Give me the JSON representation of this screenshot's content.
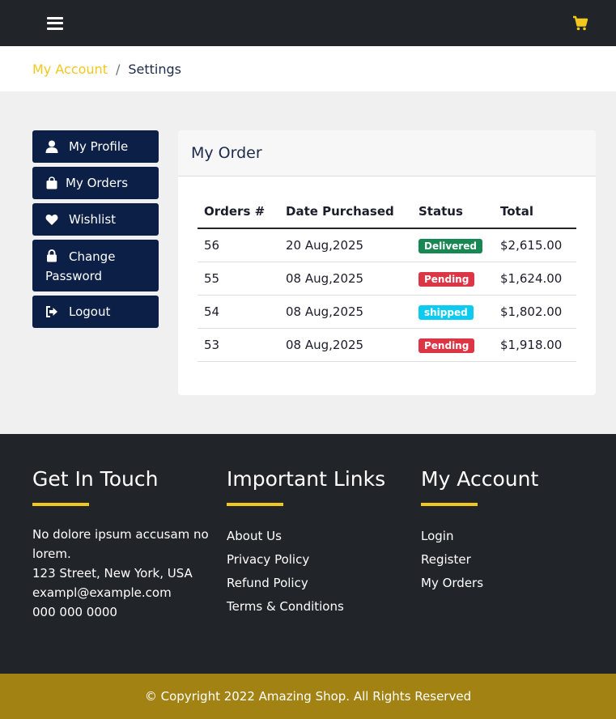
{
  "header": {
    "menu_icon": "hamburger-icon",
    "cart_icon": "shopping-cart-icon",
    "cart_color": "#f2c81c"
  },
  "breadcrumb": {
    "parent": "My Account",
    "separator": "/",
    "current": "Settings"
  },
  "sidebar": {
    "items": [
      {
        "label": "My Profile",
        "icon": "user-icon"
      },
      {
        "label": "My Orders",
        "icon": "shopping-bag-icon"
      },
      {
        "label": "Wishlist",
        "icon": "heart-icon"
      },
      {
        "label": "Change Password",
        "icon": "lock-icon"
      },
      {
        "label": "Logout",
        "icon": "logout-icon"
      }
    ]
  },
  "orders": {
    "title": "My Order",
    "columns": [
      "Orders #",
      "Date Purchased",
      "Status",
      "Total"
    ],
    "rows": [
      {
        "id": "56",
        "date": "20 Aug,2025",
        "status": "Delivered",
        "status_color": "#198754",
        "total": "$2,615.00"
      },
      {
        "id": "55",
        "date": "08 Aug,2025",
        "status": "Pending",
        "status_color": "#dc3545",
        "total": "$1,624.00"
      },
      {
        "id": "54",
        "date": "08 Aug,2025",
        "status": "shipped",
        "status_color": "#0dcaf0",
        "total": "$1,802.00"
      },
      {
        "id": "53",
        "date": "08 Aug,2025",
        "status": "Pending",
        "status_color": "#dc3545",
        "total": "$1,918.00"
      }
    ]
  },
  "footer": {
    "contact": {
      "title": "Get In Touch",
      "lines": [
        "No dolore ipsum accusam no lorem.",
        "123 Street, New York, USA",
        "exampl@example.com",
        "000 000 0000"
      ]
    },
    "links": {
      "title": "Important Links",
      "items": [
        "About Us",
        "Privacy Policy",
        "Refund Policy",
        "Terms & Conditions"
      ]
    },
    "account": {
      "title": "My Account",
      "items": [
        "Login",
        "Register",
        "My Orders"
      ]
    },
    "copyright": "© Copyright 2022 Amazing Shop. All Rights Reserved"
  },
  "colors": {
    "accent": "#f2c81c",
    "nav_dark": "#0c1f47",
    "footer_bg": "#212529",
    "copyright_bg": "#a28213"
  }
}
